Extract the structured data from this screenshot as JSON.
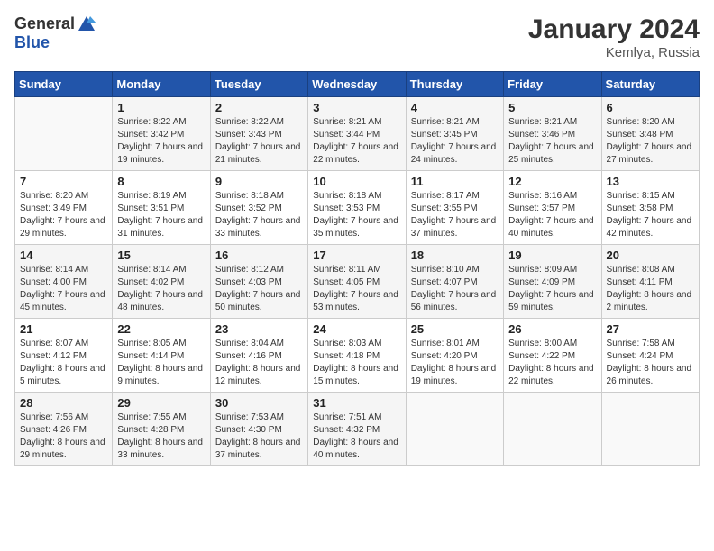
{
  "header": {
    "logo_general": "General",
    "logo_blue": "Blue",
    "month": "January 2024",
    "location": "Kemlya, Russia"
  },
  "days_of_week": [
    "Sunday",
    "Monday",
    "Tuesday",
    "Wednesday",
    "Thursday",
    "Friday",
    "Saturday"
  ],
  "weeks": [
    [
      {
        "day": "",
        "sunrise": "",
        "sunset": "",
        "daylight": ""
      },
      {
        "day": "1",
        "sunrise": "8:22 AM",
        "sunset": "3:42 PM",
        "daylight": "7 hours and 19 minutes."
      },
      {
        "day": "2",
        "sunrise": "8:22 AM",
        "sunset": "3:43 PM",
        "daylight": "7 hours and 21 minutes."
      },
      {
        "day": "3",
        "sunrise": "8:21 AM",
        "sunset": "3:44 PM",
        "daylight": "7 hours and 22 minutes."
      },
      {
        "day": "4",
        "sunrise": "8:21 AM",
        "sunset": "3:45 PM",
        "daylight": "7 hours and 24 minutes."
      },
      {
        "day": "5",
        "sunrise": "8:21 AM",
        "sunset": "3:46 PM",
        "daylight": "7 hours and 25 minutes."
      },
      {
        "day": "6",
        "sunrise": "8:20 AM",
        "sunset": "3:48 PM",
        "daylight": "7 hours and 27 minutes."
      }
    ],
    [
      {
        "day": "7",
        "sunrise": "8:20 AM",
        "sunset": "3:49 PM",
        "daylight": "7 hours and 29 minutes."
      },
      {
        "day": "8",
        "sunrise": "8:19 AM",
        "sunset": "3:51 PM",
        "daylight": "7 hours and 31 minutes."
      },
      {
        "day": "9",
        "sunrise": "8:18 AM",
        "sunset": "3:52 PM",
        "daylight": "7 hours and 33 minutes."
      },
      {
        "day": "10",
        "sunrise": "8:18 AM",
        "sunset": "3:53 PM",
        "daylight": "7 hours and 35 minutes."
      },
      {
        "day": "11",
        "sunrise": "8:17 AM",
        "sunset": "3:55 PM",
        "daylight": "7 hours and 37 minutes."
      },
      {
        "day": "12",
        "sunrise": "8:16 AM",
        "sunset": "3:57 PM",
        "daylight": "7 hours and 40 minutes."
      },
      {
        "day": "13",
        "sunrise": "8:15 AM",
        "sunset": "3:58 PM",
        "daylight": "7 hours and 42 minutes."
      }
    ],
    [
      {
        "day": "14",
        "sunrise": "8:14 AM",
        "sunset": "4:00 PM",
        "daylight": "7 hours and 45 minutes."
      },
      {
        "day": "15",
        "sunrise": "8:14 AM",
        "sunset": "4:02 PM",
        "daylight": "7 hours and 48 minutes."
      },
      {
        "day": "16",
        "sunrise": "8:12 AM",
        "sunset": "4:03 PM",
        "daylight": "7 hours and 50 minutes."
      },
      {
        "day": "17",
        "sunrise": "8:11 AM",
        "sunset": "4:05 PM",
        "daylight": "7 hours and 53 minutes."
      },
      {
        "day": "18",
        "sunrise": "8:10 AM",
        "sunset": "4:07 PM",
        "daylight": "7 hours and 56 minutes."
      },
      {
        "day": "19",
        "sunrise": "8:09 AM",
        "sunset": "4:09 PM",
        "daylight": "7 hours and 59 minutes."
      },
      {
        "day": "20",
        "sunrise": "8:08 AM",
        "sunset": "4:11 PM",
        "daylight": "8 hours and 2 minutes."
      }
    ],
    [
      {
        "day": "21",
        "sunrise": "8:07 AM",
        "sunset": "4:12 PM",
        "daylight": "8 hours and 5 minutes."
      },
      {
        "day": "22",
        "sunrise": "8:05 AM",
        "sunset": "4:14 PM",
        "daylight": "8 hours and 9 minutes."
      },
      {
        "day": "23",
        "sunrise": "8:04 AM",
        "sunset": "4:16 PM",
        "daylight": "8 hours and 12 minutes."
      },
      {
        "day": "24",
        "sunrise": "8:03 AM",
        "sunset": "4:18 PM",
        "daylight": "8 hours and 15 minutes."
      },
      {
        "day": "25",
        "sunrise": "8:01 AM",
        "sunset": "4:20 PM",
        "daylight": "8 hours and 19 minutes."
      },
      {
        "day": "26",
        "sunrise": "8:00 AM",
        "sunset": "4:22 PM",
        "daylight": "8 hours and 22 minutes."
      },
      {
        "day": "27",
        "sunrise": "7:58 AM",
        "sunset": "4:24 PM",
        "daylight": "8 hours and 26 minutes."
      }
    ],
    [
      {
        "day": "28",
        "sunrise": "7:56 AM",
        "sunset": "4:26 PM",
        "daylight": "8 hours and 29 minutes."
      },
      {
        "day": "29",
        "sunrise": "7:55 AM",
        "sunset": "4:28 PM",
        "daylight": "8 hours and 33 minutes."
      },
      {
        "day": "30",
        "sunrise": "7:53 AM",
        "sunset": "4:30 PM",
        "daylight": "8 hours and 37 minutes."
      },
      {
        "day": "31",
        "sunrise": "7:51 AM",
        "sunset": "4:32 PM",
        "daylight": "8 hours and 40 minutes."
      },
      {
        "day": "",
        "sunrise": "",
        "sunset": "",
        "daylight": ""
      },
      {
        "day": "",
        "sunrise": "",
        "sunset": "",
        "daylight": ""
      },
      {
        "day": "",
        "sunrise": "",
        "sunset": "",
        "daylight": ""
      }
    ]
  ],
  "labels": {
    "sunrise_prefix": "Sunrise: ",
    "sunset_prefix": "Sunset: ",
    "daylight_prefix": "Daylight: "
  }
}
